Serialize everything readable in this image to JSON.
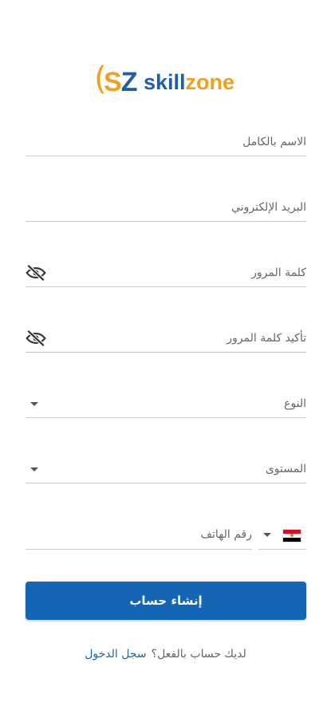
{
  "brand": {
    "paren": "(",
    "letter_s": "S",
    "letter_z": "Z",
    "word_skill": "skill",
    "word_zone": "zone",
    "colors": {
      "blue": "#1f5fa8",
      "orange": "#f0a020"
    }
  },
  "form": {
    "full_name_label": "الاسم بالكامل",
    "email_label": "البريد الإلكتروني",
    "password_label": "كلمة المرور",
    "confirm_password_label": "تأكيد كلمة المرور",
    "gender_label": "النوع",
    "level_label": "المستوى",
    "phone_label": "رقم الهاتف",
    "country_flag": "egypt-flag",
    "password_visibility_icon": "eye-off-icon"
  },
  "actions": {
    "submit_label": "إنشاء حساب",
    "have_account_text": "لديك حساب بالفعل؟",
    "signin_link": "سجل الدخول"
  },
  "colors": {
    "primary": "#1565b5",
    "underline": "#c9c9c9",
    "label": "#666666"
  }
}
